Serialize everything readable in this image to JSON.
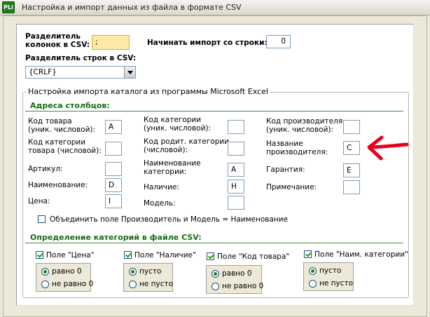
{
  "window": {
    "title": "Настройка и импорт данных из файла в формате CSV",
    "icon": "app-icon",
    "icon_text": "PLi"
  },
  "top": {
    "col_sep_label_line1": "Разделитель",
    "col_sep_label_line2": "колонок в CSV:",
    "col_sep_value": ";",
    "start_row_label": "Начинать импорт со строки:",
    "start_row_value": "0",
    "row_sep_label": "Разделитель строк в CSV:",
    "row_sep_value": "{CRLF}"
  },
  "excel_group": {
    "title": "Настройка импорта каталога из программы Microsoft Excel",
    "columns_section": "Адреса столбцов:",
    "fields": {
      "product_code_l1": "Код товара",
      "product_code_l2": "(уник. числовой):",
      "product_code_value": "A",
      "product_cat_code_l1": "Код категории",
      "product_cat_code_l2": "товара (числовой):",
      "product_cat_code_value": "",
      "article": "Артикул:",
      "article_value": "",
      "name": "Наименование:",
      "name_value": "D",
      "price": "Цена:",
      "price_value": "I",
      "cat_code_l1": "Код категории",
      "cat_code_l2": "(уник. числовой):",
      "cat_code_value": "",
      "parent_cat_l1": "Код родит. категории",
      "parent_cat_l2": "(числовой):",
      "parent_cat_value": "",
      "cat_name_l1": "Наименование",
      "cat_name_l2": "категории:",
      "cat_name_value": "A",
      "availability": "Наличие:",
      "availability_value": "H",
      "model": "Модель:",
      "model_value": "",
      "mfr_code_l1": "Код производителя",
      "mfr_code_l2": "(уник. числовой):",
      "mfr_code_value": "",
      "mfr_name_l1": "Название",
      "mfr_name_l2": "производителя:",
      "mfr_name_value": "C",
      "warranty": "Гарантия:",
      "warranty_value": "E",
      "note": "Примечание:",
      "note_value": ""
    },
    "merge_label": "Объединить поле Производитель и Модель = Наименование",
    "merge_checked": false,
    "category_section": "Определение категорий в файле CSV:",
    "groups": [
      {
        "title": "Поле \"Цена\"",
        "checked": true,
        "opt1": "равно 0",
        "opt2": "не равно 0",
        "selected": 1
      },
      {
        "title": "Поле \"Наличие\"",
        "checked": true,
        "opt1": "пусто",
        "opt2": "не пусто",
        "selected": 1
      },
      {
        "title": "Поле \"Код товара\"",
        "checked": true,
        "opt1": "равно 0",
        "opt2": "не равно 0",
        "selected": 1
      },
      {
        "title": "Поле \"Наим. категории\"",
        "checked": true,
        "opt1": "пусто",
        "opt2": "не пусто",
        "selected": 1
      }
    ]
  },
  "colors": {
    "section_green": "#1a6c1a",
    "input_highlight": "#ffe9a8",
    "annotation_arrow": "#e8001c"
  }
}
